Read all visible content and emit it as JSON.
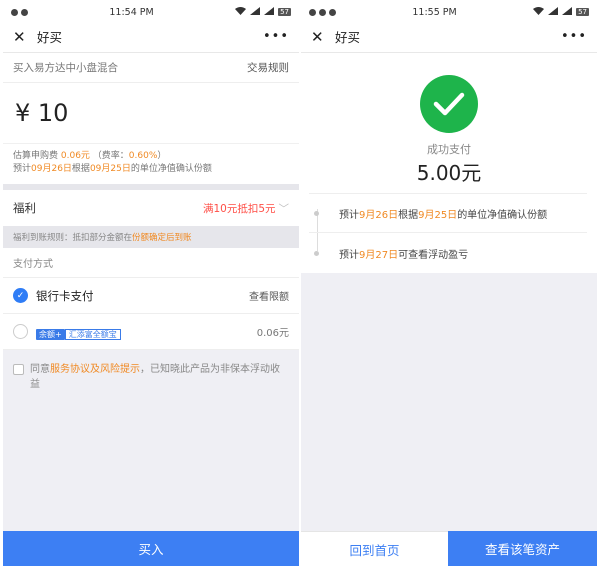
{
  "left": {
    "status": {
      "time": "11:54 PM",
      "battery": "57"
    },
    "nav": {
      "title": "好买"
    },
    "fund": {
      "name": "买入易方达中小盘混合",
      "rule_link": "交易规则"
    },
    "amount": "¥ 10",
    "fees": {
      "p1": "估算申购费 ",
      "fee": "0.06元",
      "p2": " （费率：",
      "rate": "0.60%",
      "p3": "）",
      "l2a": "预计",
      "d1": "09月26日",
      "l2b": "根据",
      "d2": "09月25日",
      "l2c": "的单位净值确认份额"
    },
    "benefit": {
      "label": "福利",
      "value": "满10元抵扣5元"
    },
    "benefit_rule": {
      "text": "福利到账规则：抵扣部分金额在",
      "highlight": "份额确定后到账"
    },
    "payment": {
      "header": "支付方式",
      "bank_label": "银行卡支付",
      "limit_link": "查看限额",
      "yue_badge": "余额+",
      "yue_name": "汇添富全额宝",
      "yue_amount": "0.06元"
    },
    "agree": {
      "a": "同意",
      "b": "服务协议及风险提示",
      "c": "，已知晓此产品为非保本浮动收益"
    },
    "buy_button": "买入"
  },
  "right": {
    "status": {
      "time": "11:55 PM",
      "battery": "57"
    },
    "nav": {
      "title": "好买"
    },
    "success": {
      "label": "成功支付",
      "amount": "5.00元"
    },
    "timeline": {
      "i1a": "预计",
      "i1d1": "9月26日",
      "i1b": "根据",
      "i1d2": "9月25日",
      "i1c": "的单位净值确认份额",
      "i2a": "预计",
      "i2d": "9月27日",
      "i2b": "可查看浮动盈亏"
    },
    "home_button": "回到首页",
    "asset_button": "查看该笔资产"
  },
  "colors": {
    "accent": "#3d7ff3",
    "success": "#1eb44b",
    "warn": "#f08a24",
    "red": "#ff4e46"
  },
  "icons": [
    "close-icon",
    "more-icon",
    "check-icon",
    "wifi-icon",
    "signal-icon",
    "battery-icon",
    "checkmark-icon"
  ]
}
